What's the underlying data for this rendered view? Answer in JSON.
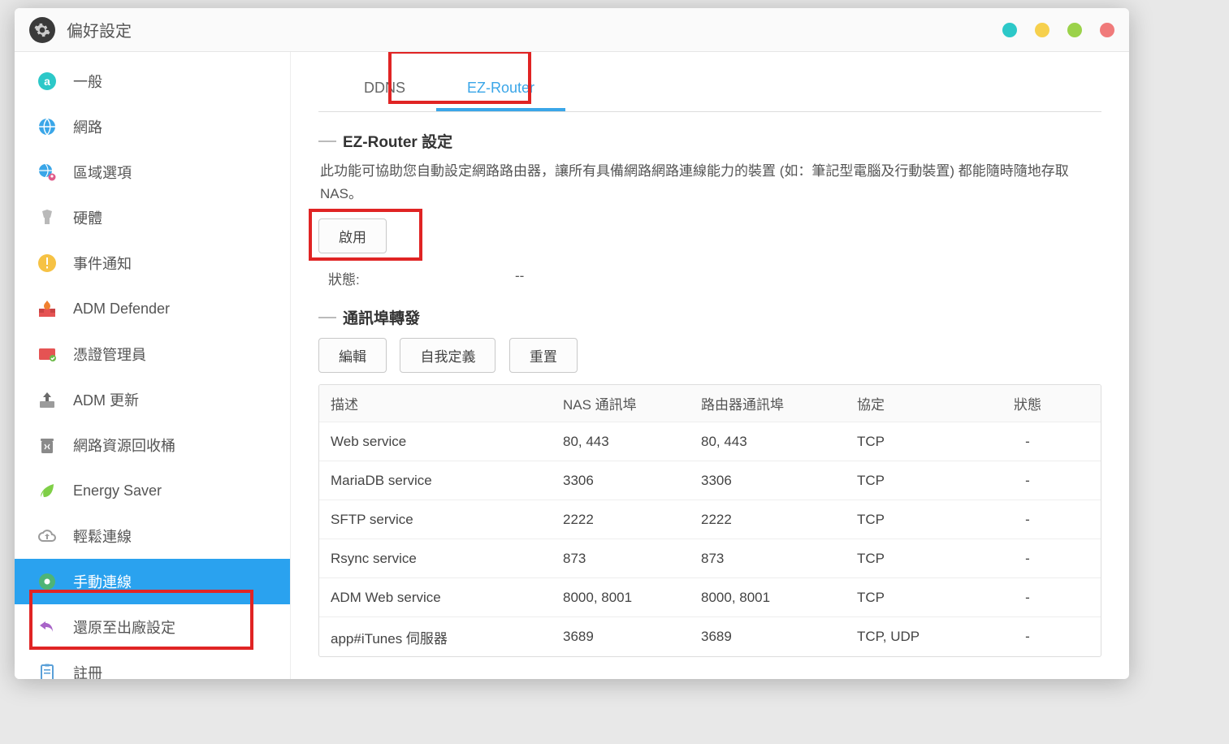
{
  "window_title": "偏好設定",
  "sidebar": {
    "items": [
      {
        "id": "general",
        "label": "一般",
        "icon": "a-icon",
        "color": "#2cc8c8"
      },
      {
        "id": "network",
        "label": "網路",
        "icon": "globe-icon",
        "color": "#3aa6e8"
      },
      {
        "id": "region",
        "label": "區域選項",
        "icon": "world-pin-icon",
        "color": "#3aa6e8"
      },
      {
        "id": "hardware",
        "label": "硬體",
        "icon": "chip-icon",
        "color": "#b9b9b9"
      },
      {
        "id": "events",
        "label": "事件通知",
        "icon": "alert-icon",
        "color": "#f6c244"
      },
      {
        "id": "defender",
        "label": "ADM Defender",
        "icon": "firewall-icon",
        "color": "#e55353"
      },
      {
        "id": "cert",
        "label": "憑證管理員",
        "icon": "cert-icon",
        "color": "#e55353"
      },
      {
        "id": "update",
        "label": "ADM 更新",
        "icon": "upload-icon",
        "color": "#9b9b9b"
      },
      {
        "id": "recycle",
        "label": "網路資源回收桶",
        "icon": "trash-icon",
        "color": "#8a8a8a"
      },
      {
        "id": "energy",
        "label": "Energy Saver",
        "icon": "leaf-icon",
        "color": "#7fcf47"
      },
      {
        "id": "ezconnect",
        "label": "輕鬆連線",
        "icon": "cloud-up-icon",
        "color": "#9b9b9b"
      },
      {
        "id": "manual",
        "label": "手動連線",
        "icon": "gear-green-icon",
        "color": "#58b958",
        "active": true
      },
      {
        "id": "factory",
        "label": "還原至出廠設定",
        "icon": "undo-icon",
        "color": "#a864c8"
      },
      {
        "id": "register",
        "label": "註冊",
        "icon": "clipboard-icon",
        "color": "#5aa0d8"
      }
    ]
  },
  "tabs": {
    "items": [
      {
        "id": "ddns",
        "label": "DDNS"
      },
      {
        "id": "ezrouter",
        "label": "EZ-Router",
        "active": true
      }
    ]
  },
  "ezrouter": {
    "section_title": "EZ-Router 設定",
    "description": "此功能可協助您自動設定網路路由器，讓所有具備網路網路連線能力的裝置 (如：筆記型電腦及行動裝置) 都能隨時隨地存取 NAS。",
    "enable_btn": "啟用",
    "status_label": "狀態:",
    "status_value": "--"
  },
  "portfw": {
    "section_title": "通訊埠轉發",
    "edit_btn": "編輯",
    "custom_btn": "自我定義",
    "reset_btn": "重置",
    "columns": {
      "desc": "描述",
      "nas": "NAS 通訊埠",
      "router": "路由器通訊埠",
      "proto": "協定",
      "status": "狀態"
    },
    "rows": [
      {
        "desc": "Web service",
        "nas": "80, 443",
        "router": "80, 443",
        "proto": "TCP",
        "status": "-"
      },
      {
        "desc": "MariaDB service",
        "nas": "3306",
        "router": "3306",
        "proto": "TCP",
        "status": "-"
      },
      {
        "desc": "SFTP service",
        "nas": "2222",
        "router": "2222",
        "proto": "TCP",
        "status": "-"
      },
      {
        "desc": "Rsync service",
        "nas": "873",
        "router": "873",
        "proto": "TCP",
        "status": "-"
      },
      {
        "desc": "ADM Web service",
        "nas": "8000, 8001",
        "router": "8000, 8001",
        "proto": "TCP",
        "status": "-"
      },
      {
        "desc": "app#iTunes 伺服器",
        "nas": "3689",
        "router": "3689",
        "proto": "TCP, UDP",
        "status": "-"
      }
    ]
  }
}
